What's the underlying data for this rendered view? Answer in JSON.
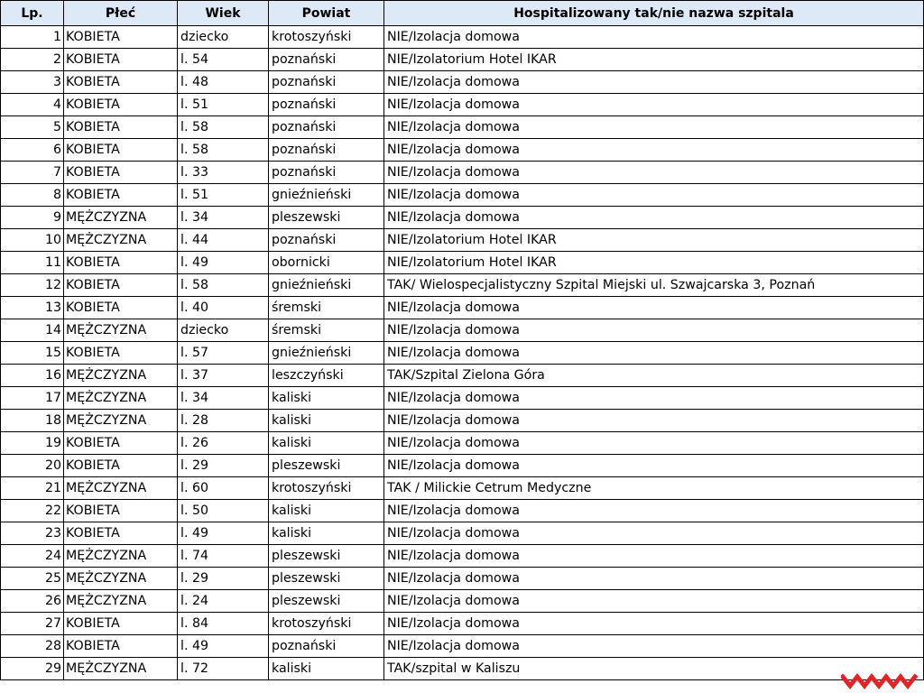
{
  "headers": [
    "Lp.",
    "Płeć",
    "Wiek",
    "Powiat",
    "Hospitalizowany tak/nie nazwa szpitala"
  ],
  "rows": [
    [
      "1",
      "KOBIETA",
      "dziecko",
      "krotoszyński",
      "NIE/Izolacja domowa"
    ],
    [
      "2",
      "KOBIETA",
      "l.  54",
      "poznański",
      "NIE/Izolatorium Hotel IKAR"
    ],
    [
      "3",
      "KOBIETA",
      "l.  48",
      "poznański",
      "NIE/Izolacja domowa"
    ],
    [
      "4",
      "KOBIETA",
      "l.  51",
      "poznański",
      "NIE/Izolacja domowa"
    ],
    [
      "5",
      "KOBIETA",
      "l.  58",
      "poznański",
      "NIE/Izolacja domowa"
    ],
    [
      "6",
      "KOBIETA",
      "l.  58",
      "poznański",
      "NIE/Izolacja domowa"
    ],
    [
      "7",
      "KOBIETA",
      "l.  33",
      "poznański",
      "NIE/Izolacja domowa"
    ],
    [
      "8",
      "KOBIETA",
      "l.  51",
      "gnieźnieński",
      "NIE/Izolacja domowa"
    ],
    [
      "9",
      "MĘŻCZYZNA",
      "l.  34",
      "pleszewski",
      "NIE/Izolacja domowa"
    ],
    [
      "10",
      "MĘŻCZYZNA",
      "l.  44",
      "poznański",
      "NIE/Izolatorium Hotel IKAR"
    ],
    [
      "11",
      "KOBIETA",
      "l.  49",
      "obornicki",
      "NIE/Izolatorium Hotel IKAR"
    ],
    [
      "12",
      "KOBIETA",
      "l.  58",
      "gnieźnieński",
      "TAK/ Wielospecjalistyczny Szpital Miejski ul. Szwajcarska 3, Poznań"
    ],
    [
      "13",
      "KOBIETA",
      "l.  40",
      "śremski",
      "NIE/Izolacja domowa"
    ],
    [
      "14",
      "MĘŻCZYZNA",
      "dziecko",
      "śremski",
      "NIE/Izolacja domowa"
    ],
    [
      "15",
      "KOBIETA",
      "l.  57",
      "gnieźnieński",
      "NIE/Izolacja domowa"
    ],
    [
      "16",
      "MĘŻCZYZNA",
      "l.  37",
      "leszczyński",
      "TAK/Szpital Zielona Góra"
    ],
    [
      "17",
      "MĘŻCZYZNA",
      "l.  34",
      "kaliski",
      "NIE/Izolacja domowa"
    ],
    [
      "18",
      "MĘŻCZYZNA",
      "l.  28",
      "kaliski",
      "NIE/Izolacja domowa"
    ],
    [
      "19",
      "KOBIETA",
      "l.  26",
      "kaliski",
      "NIE/Izolacja domowa"
    ],
    [
      "20",
      "KOBIETA",
      "l.  29",
      "pleszewski",
      "NIE/Izolacja domowa"
    ],
    [
      "21",
      "MĘŻCZYZNA",
      "l.  60",
      "krotoszyński",
      "TAK / Milickie Cetrum Medyczne"
    ],
    [
      "22",
      "KOBIETA",
      "l.  50",
      "kaliski",
      "NIE/Izolacja domowa"
    ],
    [
      "23",
      "KOBIETA",
      "l.  49",
      "kaliski",
      "NIE/Izolacja domowa"
    ],
    [
      "24",
      "MĘŻCZYZNA",
      "l.  74",
      "pleszewski",
      "NIE/Izolacja domowa"
    ],
    [
      "25",
      "MĘŻCZYZNA",
      "l.  29",
      "pleszewski",
      "NIE/Izolacja domowa"
    ],
    [
      "26",
      "MĘŻCZYZNA",
      "l.  24",
      "pleszewski",
      "NIE/Izolacja domowa"
    ],
    [
      "27",
      "KOBIETA",
      "l.  84",
      "krotoszyński",
      "NIE/Izolacja domowa"
    ],
    [
      "28",
      "KOBIETA",
      "l.  49",
      "poznański",
      "NIE/Izolacja domowa"
    ],
    [
      "29",
      "MĘŻCZYZNA",
      "l.  72",
      "kaliski",
      "TAK/szpital w Kaliszu"
    ]
  ],
  "colors": {
    "header_bg": "#dde9f6",
    "logo": "#e2232a"
  }
}
